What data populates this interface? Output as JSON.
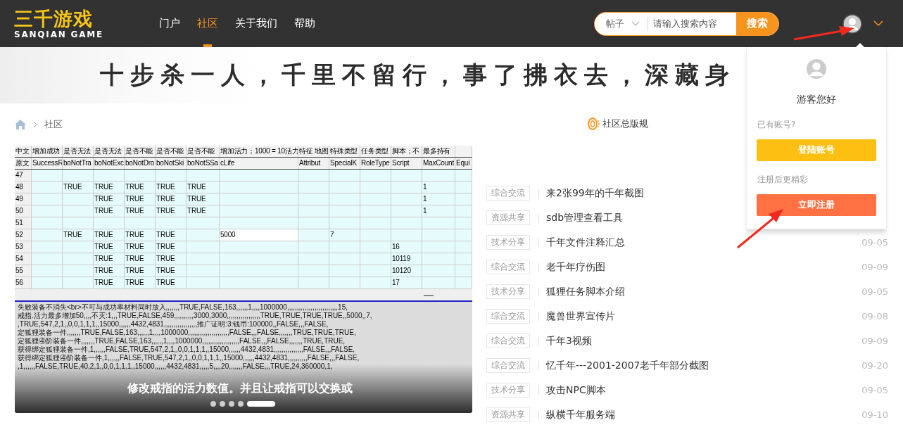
{
  "header": {
    "logo": {
      "title": "三千游戏",
      "subtitle": "SANQIAN GAME"
    },
    "nav": [
      {
        "label": "门户",
        "selected": false
      },
      {
        "label": "社区",
        "selected": true
      },
      {
        "label": "关于我们",
        "selected": false
      },
      {
        "label": "帮助",
        "selected": false
      }
    ],
    "search": {
      "scope": "帖子",
      "placeholder": "请输入搜索内容",
      "button": "搜索"
    }
  },
  "banner": {
    "slogan": "十步杀一人，千里不留行，事了拂衣去，深藏身"
  },
  "breadcrumb": [
    "社区"
  ],
  "rules_link": "社区总版规",
  "carousel": {
    "caption": "修改戒指的活力数值。并且让戒指可以交换或",
    "dots": [
      {
        "selected": false
      },
      {
        "selected": false
      },
      {
        "selected": false
      },
      {
        "selected": false
      },
      {
        "selected": true
      }
    ],
    "sheet": {
      "header_rows": [
        [
          "中文",
          "增加成功",
          "是否无法",
          "是否无法",
          "是否不能",
          "是否不能",
          "是否不能",
          "增加活力；1000 = 10活力",
          "特征 地图",
          "特殊类型",
          "任务类型",
          "脚本；不",
          "最多持有",
          null
        ],
        [
          "原文",
          "SuccessR",
          "boNotTra",
          "boNotExc",
          "boNotDro",
          "boNotSki",
          "boNotSSa",
          "cLife",
          "Attribut",
          "SpecialK",
          "RoleType",
          "Script",
          "MaxCount",
          "Equi"
        ]
      ],
      "rows": [
        [
          "47",
          null,
          null,
          null,
          null,
          null,
          null,
          null,
          null,
          null,
          null,
          null,
          null,
          null
        ],
        [
          "48",
          null,
          "TRUE",
          "TRUE",
          "TRUE",
          "TRUE",
          "TRUE",
          null,
          null,
          null,
          null,
          null,
          "1",
          null
        ],
        [
          "49",
          null,
          null,
          "TRUE",
          "TRUE",
          "TRUE",
          "TRUE",
          null,
          null,
          null,
          null,
          null,
          "1",
          null
        ],
        [
          "50",
          null,
          null,
          "TRUE",
          "TRUE",
          "TRUE",
          "TRUE",
          null,
          null,
          null,
          null,
          null,
          "1",
          null
        ],
        [
          "51",
          null,
          null,
          null,
          null,
          null,
          null,
          null,
          null,
          null,
          null,
          null,
          null,
          null
        ],
        [
          "52",
          null,
          "TRUE",
          "TRUE",
          "TRUE",
          "TRUE",
          null,
          "5000",
          null,
          "7",
          null,
          null,
          null,
          null
        ],
        [
          "53",
          null,
          null,
          "TRUE",
          "TRUE",
          "TRUE",
          null,
          null,
          null,
          null,
          null,
          "16",
          null,
          null
        ],
        [
          "54",
          null,
          null,
          "TRUE",
          "TRUE",
          "TRUE",
          null,
          null,
          null,
          null,
          null,
          "10119",
          null,
          null
        ],
        [
          "55",
          null,
          null,
          "TRUE",
          "TRUE",
          "TRUE",
          null,
          null,
          null,
          null,
          null,
          "10120",
          null,
          null
        ],
        [
          "56",
          null,
          null,
          "TRUE",
          "TRUE",
          "TRUE",
          null,
          null,
          null,
          null,
          null,
          "17",
          null,
          null
        ]
      ],
      "text_lines": [
        "失败装备不消失<br>不可与成功率材料同时放入,,,,,,,TRUE,FALSE,163,,,,,,1,,,,1000000,,,,,,,,,,,,,,,,,,,,,,,,,,15,",
        "戒指.活力最多增加50,,,,不灭:1,,,TRUE,FALSE,459,,,,,,,,,,3000,3000,,,,,,,,,,,,,,,,,TRUE,TRUE,TRUE,TRUE,,5000,,7,",
        ",TRUE,547,2,1,,0,0,1,1,1,,15000,,,,,,4432,4831,,,,,,,,,,,,,,,,,推广证明:3:钱币:100000,,FALSE,,,FALSE,",
        "定狐狸装备一件,,,,,,,TRUE,FALSE,163,,,,,,1,,,,1000000,,,,,,,,,,,,,,,,,,,,,FALSE,,,FALSE,,,,,,,TRUE,TRUE,TRUE,",
        "定狐狸④阶装备一件,,,,,,,TRUE,FALSE,163,,,,,,1,,,,1000000,,,,,,,,,,,,,,,,,,,FALSE,,,FALSE,,,,,,,TRUE,TRUE,",
        "获得绑定狐狸装备一件,1,,,,,,FALSE,TRUE,547,2,1,,0,0,1,1,1,,15000,,,,,,4432,4831,,,,,,,,,,,,,,,FALSE,,,FALSE,",
        "获得绑定狐狸④阶装备一件,1,,,,,,FALSE,TRUE,547,2,1,,0,0,1,1,1,,15000,,,,,,4432,4831,,,,,,,,,,FALSE,,,FALSE,",
        ",1,,,,,,FALSE,TRUE,40,2,1,,0,0,1,1,1,,15000,,,,,,4432,4831,,,,,5,,,,20,,,,,,,FALSE,,,TRUE,24,360000,1,"
      ]
    }
  },
  "posts": [
    {
      "tag": "综合交流",
      "title": "来2张99年的千年截图"
    },
    {
      "tag": "资源共享",
      "title": "sdb管理查看工具"
    },
    {
      "tag": "技术分享",
      "title": "千年文件注释汇总",
      "date": "09-05"
    },
    {
      "tag": "综合交流",
      "title": "老千年疗伤图",
      "date": "09-09"
    },
    {
      "tag": "技术分享",
      "title": "狐狸任务脚本介绍",
      "date": "09-05"
    },
    {
      "tag": "综合交流",
      "title": "魔兽世界宣传片",
      "date": "09-08"
    },
    {
      "tag": "综合交流",
      "title": "千年3视频",
      "date": "09-09"
    },
    {
      "tag": "综合交流",
      "title": "忆千年---2001-2007老千年部分截图",
      "date": "09-20"
    },
    {
      "tag": "技术分享",
      "title": "攻击NPC脚本",
      "date": "09-05"
    },
    {
      "tag": "资源共享",
      "title": "纵横千年服务端",
      "date": "09-10"
    }
  ],
  "user_menu": {
    "greeting": "游客您好",
    "login_prompt": "已有账号?",
    "login_button": "登陆账号",
    "register_prompt": "注册后更精彩",
    "register_button": "立即注册"
  }
}
